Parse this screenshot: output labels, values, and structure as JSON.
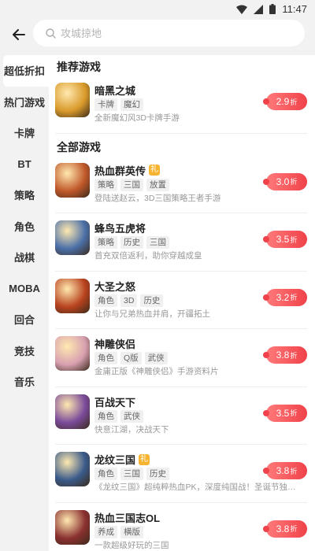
{
  "status_bar": {
    "time": "11:47"
  },
  "search": {
    "placeholder": "攻城掠地"
  },
  "sidebar": {
    "items": [
      {
        "label": "超低折扣"
      },
      {
        "label": "热门游戏"
      },
      {
        "label": "卡牌"
      },
      {
        "label": "BT"
      },
      {
        "label": "策略"
      },
      {
        "label": "角色"
      },
      {
        "label": "战棋"
      },
      {
        "label": "MOBA"
      },
      {
        "label": "回合"
      },
      {
        "label": "竞技"
      },
      {
        "label": "音乐"
      }
    ]
  },
  "recommended": {
    "title": "推荐游戏",
    "games": [
      {
        "name": "暗黑之城",
        "gift": "",
        "tags": [
          "卡牌",
          "魔幻"
        ],
        "desc": "全新魔幻风3D卡牌手游",
        "discount": "2.9",
        "unit": "折",
        "icon": "dark-city-game-icon",
        "color": "#d99a2b"
      }
    ]
  },
  "all": {
    "title": "全部游戏",
    "games": [
      {
        "name": "热血群英传",
        "gift": "礼",
        "tags": [
          "策略",
          "三国",
          "放置"
        ],
        "desc": "登陆送赵云，3D三国策略王者手游",
        "discount": "3.0",
        "unit": "折",
        "icon": "hero-legend-game-icon",
        "color": "#c0582a"
      },
      {
        "name": "蜂鸟五虎将",
        "gift": "",
        "tags": [
          "策略",
          "历史",
          "三国"
        ],
        "desc": "首充双倍返利，助你穿越成皇",
        "discount": "3.5",
        "unit": "折",
        "icon": "five-tigers-game-icon",
        "color": "#4a6fa8"
      },
      {
        "name": "大圣之怒",
        "gift": "",
        "tags": [
          "角色",
          "3D",
          "历史"
        ],
        "desc": "让你与兄弟热血并肩，开疆拓土",
        "discount": "3.2",
        "unit": "折",
        "icon": "monkey-king-game-icon",
        "color": "#b8421e"
      },
      {
        "name": "神雕侠侣",
        "gift": "",
        "tags": [
          "角色",
          "Q版",
          "武侠"
        ],
        "desc": "金庸正版《神雕侠侣》手游资料片",
        "discount": "3.8",
        "unit": "折",
        "icon": "condor-heroes-game-icon",
        "color": "#d8a0b0"
      },
      {
        "name": "百战天下",
        "gift": "",
        "tags": [
          "角色",
          "武侠"
        ],
        "desc": "快意江湖，决战天下",
        "discount": "3.5",
        "unit": "折",
        "icon": "hundred-battles-game-icon",
        "color": "#7a4a9a"
      },
      {
        "name": "龙纹三国",
        "gift": "礼",
        "tags": [
          "角色",
          "三国",
          "历史"
        ],
        "desc": "《龙纹三国》超纯粹热血PK，深度纯国战！圣诞节独家活动...",
        "discount": "3.8",
        "unit": "折",
        "icon": "dragon-three-kingdoms-game-icon",
        "color": "#3a5a8a"
      },
      {
        "name": "热血三国志OL",
        "gift": "",
        "tags": [
          "养成",
          "横版"
        ],
        "desc": "一款超级好玩的三国",
        "discount": "3.8",
        "unit": "折",
        "icon": "three-kingdoms-ol-game-icon",
        "color": "#8a3030"
      }
    ]
  }
}
